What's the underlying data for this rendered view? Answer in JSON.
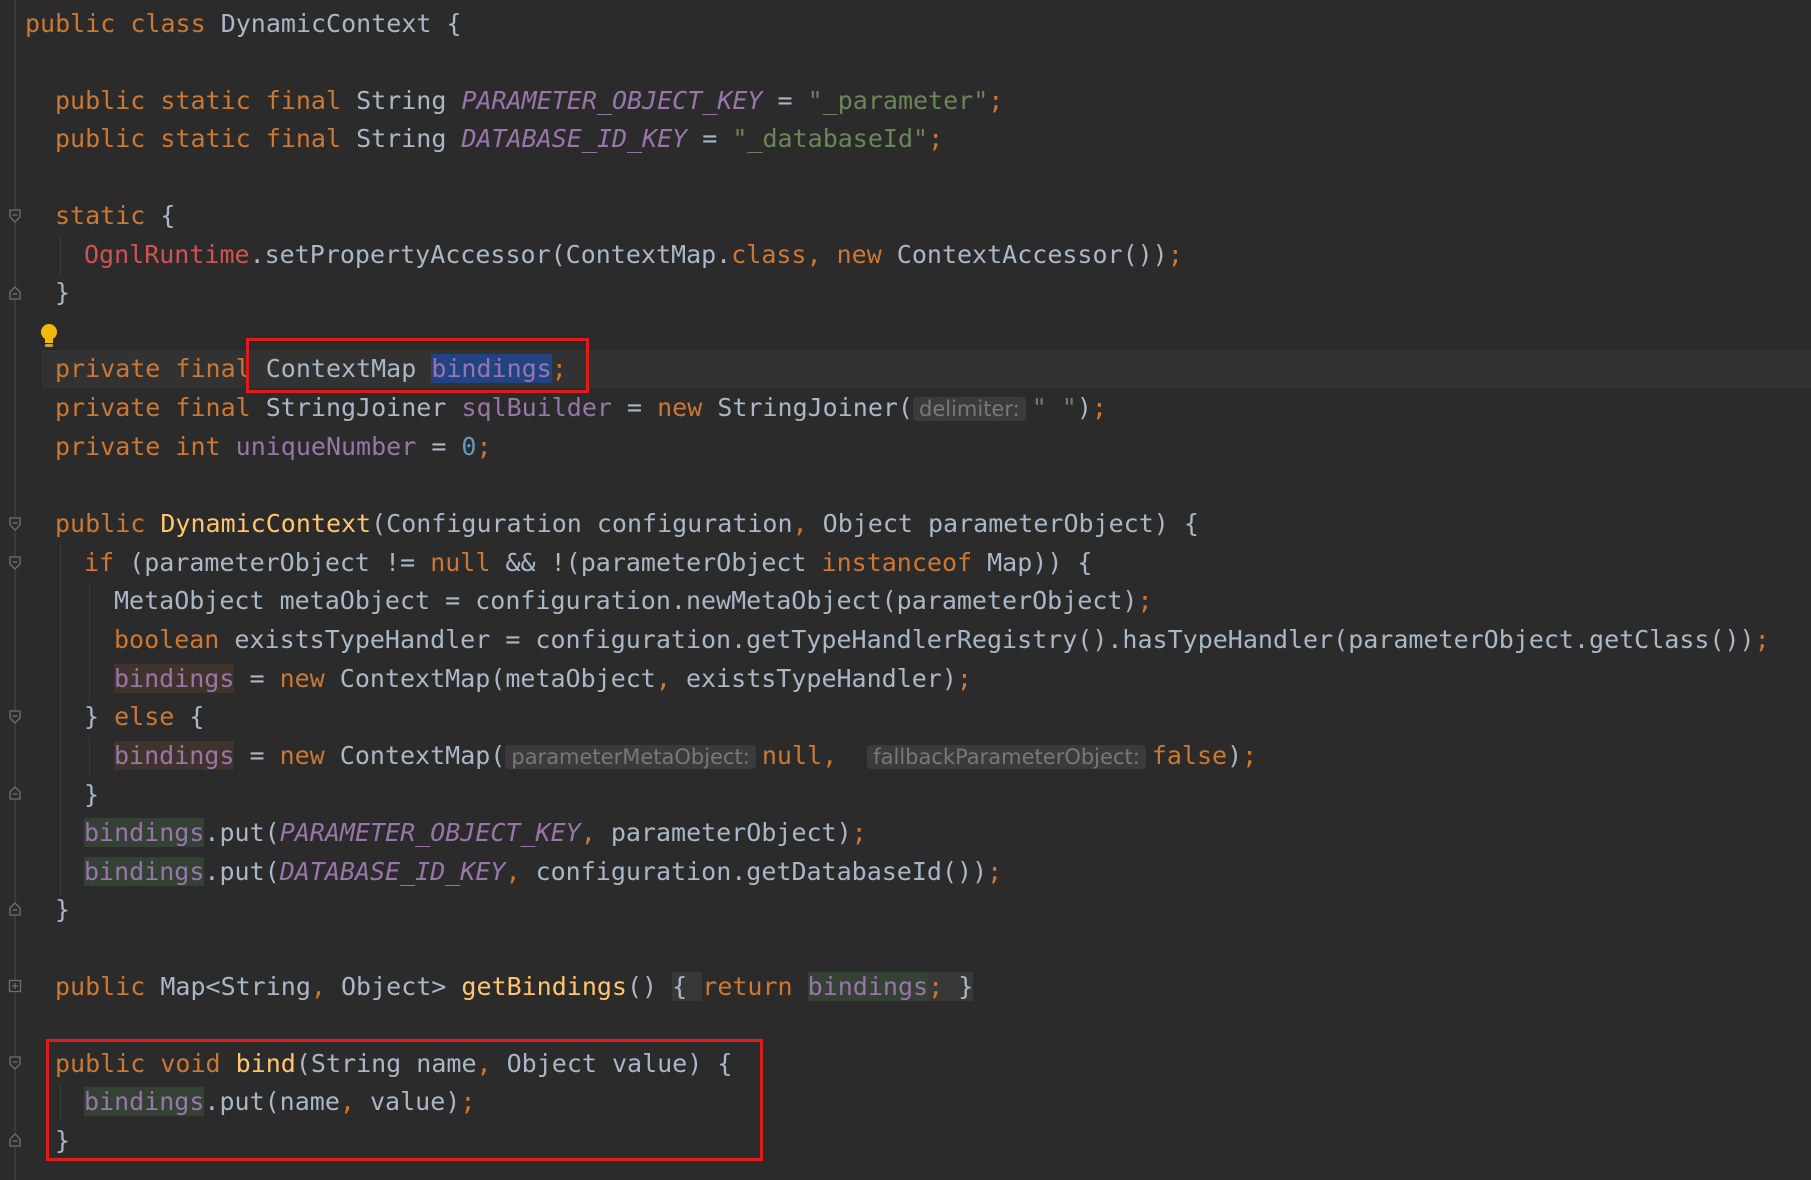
{
  "code": {
    "l1": {
      "public": "public",
      "class": "class",
      "name": "DynamicContext",
      "brace": " {"
    },
    "l2": {
      "public": "public",
      "static": "static",
      "final": "final",
      "type": "String",
      "const": "PARAMETER_OBJECT_KEY",
      "eq": " = ",
      "value": "\"_parameter\"",
      "semi": ";"
    },
    "l3": {
      "public": "public",
      "static": "static",
      "final": "final",
      "type": "String",
      "const": "DATABASE_ID_KEY",
      "eq": " = ",
      "value": "\"_databaseId\"",
      "semi": ";"
    },
    "l4": {
      "static": "static",
      "brace": " {"
    },
    "l5": {
      "cls": "OgnlRuntime",
      "call": ".setPropertyAccessor(ContextMap.",
      "classkw": "class",
      "comma": ", ",
      "new": "new",
      "rest": " ContextAccessor())",
      "semi": ";"
    },
    "l6": {
      "brace": "}"
    },
    "l7": {
      "private": "private",
      "final": "final",
      "type": "ContextMap",
      "field": "bindings",
      "semi": ";"
    },
    "l8": {
      "private": "private",
      "final": "final",
      "type": "StringJoiner",
      "field": "sqlBuilder",
      "eq": " = ",
      "new": "new",
      "ctor": " StringJoiner(",
      "hint": "delimiter:",
      "arg": "\" \"",
      "close": ")",
      "semi": ";"
    },
    "l9": {
      "private": "private",
      "int": "int",
      "field": "uniqueNumber",
      "eq": " = ",
      "num": "0",
      "semi": ";"
    },
    "l10": {
      "public": "public",
      "name": "DynamicContext",
      "p1": "(Configuration configuration",
      "comma": ", ",
      "p2": "Object parameterObject) {"
    },
    "l11": {
      "if": "if",
      "a": " (parameterObject != ",
      "null": "null",
      "b": " && !(parameterObject ",
      "instanceof": "instanceof",
      "c": " Map)) {"
    },
    "l12": {
      "text": "MetaObject metaObject = configuration.newMetaObject(parameterObject)",
      "semi": ";"
    },
    "l13": {
      "boolean": "boolean",
      "text": " existsTypeHandler = configuration.getTypeHandlerRegistry().hasTypeHandler(parameterObject.getClass())",
      "semi": ";"
    },
    "l14": {
      "field": "bindings",
      "eq": " = ",
      "new": "new",
      "a": " ContextMap(metaObject",
      "comma": ", ",
      "b": "existsTypeHandler)",
      "semi": ";"
    },
    "l15": {
      "a": "} ",
      "else": "else",
      "b": " {"
    },
    "l16": {
      "field": "bindings",
      "eq": " = ",
      "new": "new",
      "a": " ContextMap(",
      "hint1": "parameterMetaObject:",
      "null": "null",
      "comma": ", ",
      "hint2": "fallbackParameterObject:",
      "false": "false",
      "close": ")",
      "semi": ";"
    },
    "l17": {
      "brace": "}"
    },
    "l18": {
      "field": "bindings",
      "a": ".put(",
      "const": "PARAMETER_OBJECT_KEY",
      "comma": ", ",
      "b": "parameterObject)",
      "semi": ";"
    },
    "l19": {
      "field": "bindings",
      "a": ".put(",
      "const": "DATABASE_ID_KEY",
      "comma": ", ",
      "b": "configuration.getDatabaseId())",
      "semi": ";"
    },
    "l20": {
      "brace": "}"
    },
    "l21": {
      "public": "public",
      "a": " Map<String",
      "comma": ", ",
      "b": "Object> ",
      "name": "getBindings",
      "c": "()",
      "ob": "{ ",
      "return": "return",
      "field": "bindings",
      "semi": "; ",
      "cb": "}"
    },
    "l22": {
      "public": "public",
      "void": "void",
      "name": "bind",
      "a": "(String name",
      "comma": ", ",
      "b": "Object value) {"
    },
    "l23": {
      "field": "bindings",
      "a": ".put(name",
      "comma": ", ",
      "b": "value)",
      "semi": ";"
    },
    "l24": {
      "brace": "}"
    }
  },
  "colors": {
    "background": "#2b2b2b",
    "keyword": "#cc7832",
    "plain": "#a9b7c6",
    "field": "#9876aa",
    "string": "#6a8759",
    "number": "#6897bb",
    "method": "#ffc66d",
    "error": "#d25252",
    "highlight_box": "#e01b1b"
  },
  "icons": [
    "fold-icon",
    "lightbulb-icon"
  ]
}
